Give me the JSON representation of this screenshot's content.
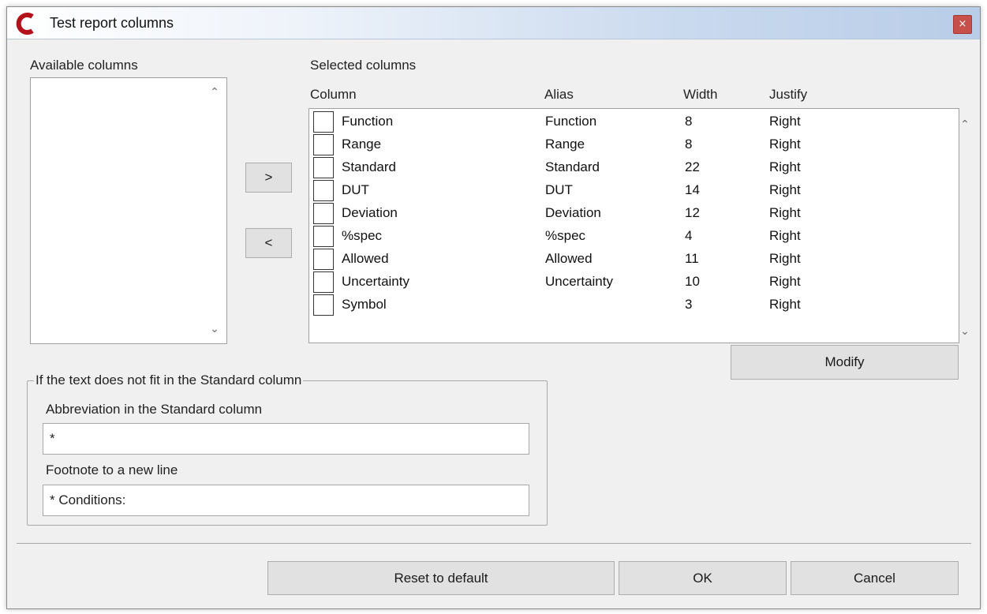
{
  "window": {
    "title": "Test report columns",
    "close_glyph": "×",
    "accent_color": "#c7504a"
  },
  "available": {
    "label": "Available columns",
    "items": []
  },
  "move_buttons": {
    "add_label": ">",
    "remove_label": "<"
  },
  "selected": {
    "label": "Selected columns",
    "headers": {
      "column": "Column",
      "alias": "Alias",
      "width": "Width",
      "justify": "Justify"
    },
    "rows": [
      {
        "column": "Function",
        "alias": "Function",
        "width": "8",
        "justify": "Right"
      },
      {
        "column": "Range",
        "alias": "Range",
        "width": "8",
        "justify": "Right"
      },
      {
        "column": "Standard",
        "alias": "Standard",
        "width": "22",
        "justify": "Right"
      },
      {
        "column": "DUT",
        "alias": "DUT",
        "width": "14",
        "justify": "Right"
      },
      {
        "column": "Deviation",
        "alias": "Deviation",
        "width": "12",
        "justify": "Right"
      },
      {
        "column": "%spec",
        "alias": "%spec",
        "width": "4",
        "justify": "Right"
      },
      {
        "column": "Allowed",
        "alias": "Allowed",
        "width": "11",
        "justify": "Right"
      },
      {
        "column": "Uncertainty",
        "alias": "Uncertainty",
        "width": "10",
        "justify": "Right"
      },
      {
        "column": "Symbol",
        "alias": "",
        "width": "3",
        "justify": "Right"
      }
    ],
    "modify_label": "Modify"
  },
  "fit_group": {
    "legend": "If the text does not fit in the Standard column",
    "abbreviation_label": "Abbreviation in the Standard column",
    "abbreviation_value": "*",
    "footnote_label": "Footnote to a new line",
    "footnote_value": "* Conditions:"
  },
  "footer": {
    "reset_label": "Reset to default",
    "ok_label": "OK",
    "cancel_label": "Cancel"
  },
  "icons": {
    "scroll_up": "chevron-up-icon",
    "scroll_down": "chevron-down-icon",
    "app": "app-logo-icon",
    "close": "close-icon"
  }
}
